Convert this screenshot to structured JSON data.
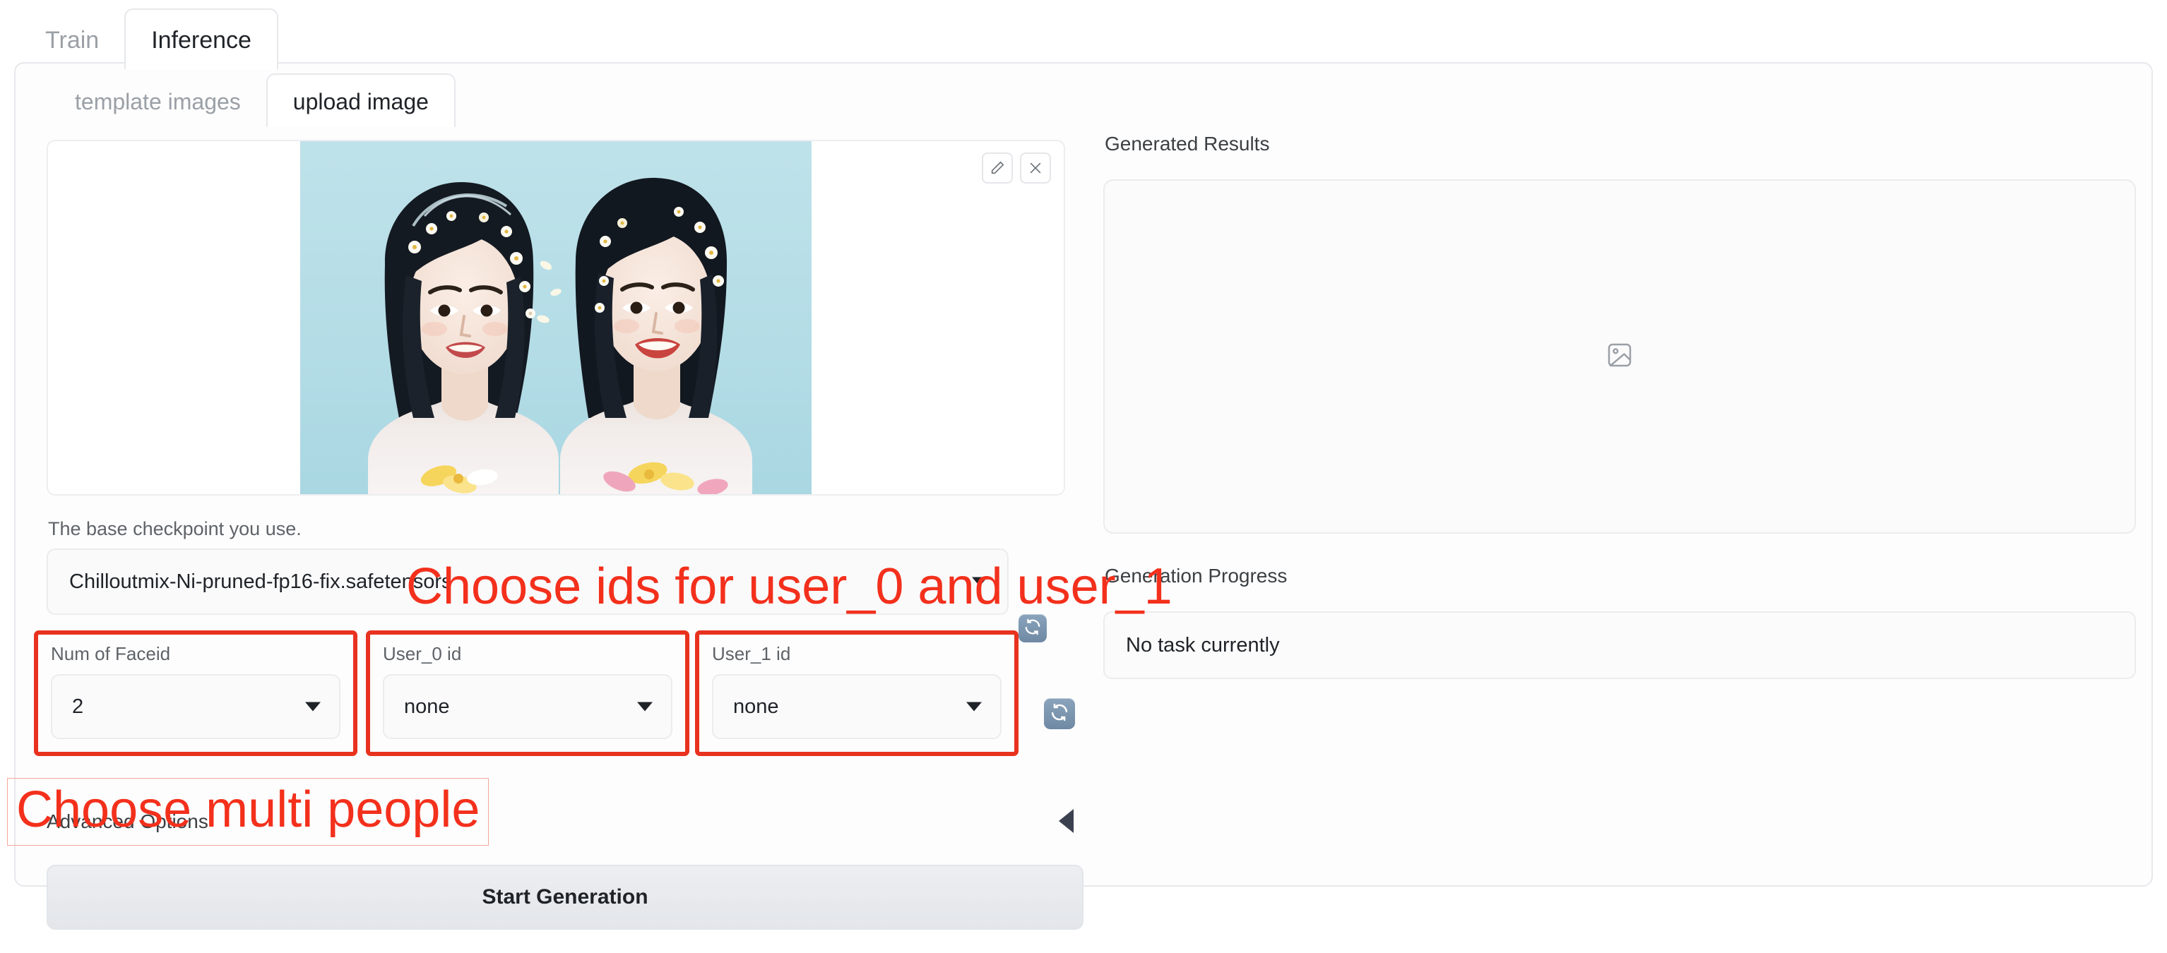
{
  "tabs": {
    "items": [
      {
        "label": "Train",
        "active": false
      },
      {
        "label": "Inference",
        "active": true
      }
    ]
  },
  "subtabs": {
    "items": [
      {
        "label": "template images",
        "active": false
      },
      {
        "label": "upload image",
        "active": true
      }
    ]
  },
  "upload": {
    "edit_icon": "pencil-icon",
    "close_icon": "close-icon",
    "image_alt": "two women with flower crowns on light blue background"
  },
  "checkpoint": {
    "label": "The base checkpoint you use.",
    "value": "Chilloutmix-Ni-pruned-fp16-fix.safetensors",
    "refresh_icon": "refresh-icon"
  },
  "faceid": {
    "label": "Num of Faceid",
    "value": "2"
  },
  "user0": {
    "label": "User_0 id",
    "value": "none"
  },
  "user1": {
    "label": "User_1 id",
    "value": "none"
  },
  "ids_refresh_icon": "refresh-icon",
  "advanced": {
    "label": "Advanced Options",
    "toggle_icon": "triangle-left-icon"
  },
  "generate": {
    "button_label": "Start Generation"
  },
  "results": {
    "label": "Generated Results",
    "placeholder_icon": "image-placeholder-icon"
  },
  "progress": {
    "label": "Generation Progress",
    "value": "No task currently"
  },
  "annotations": {
    "ids": "Choose ids for user_0 and user_1",
    "multi": "Choose multi people",
    "color": "#f3301c"
  },
  "colors": {
    "annotation_red": "#f3301c",
    "highlight_box_red": "#e8321f",
    "panel_border": "#e6e8eb",
    "field_bg": "#fafafb",
    "text_primary": "#1f2328",
    "text_muted": "#9aa0a6",
    "photo_bg": "#b7dde6"
  }
}
